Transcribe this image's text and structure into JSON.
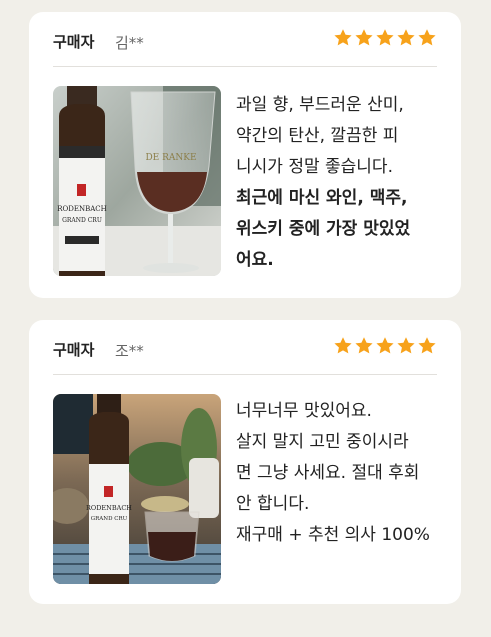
{
  "reviews": [
    {
      "buyer_label": "구매자",
      "buyer_name": "김**",
      "rating": 5,
      "photo": "wine-glass-photo",
      "lines": [
        {
          "text": "과일 향, 부드러운 산미,",
          "bold": false
        },
        {
          "text": "약간의 탄산, 깔끔한 피",
          "bold": false
        },
        {
          "text": "니시가 정말 좋습니다.",
          "bold": false
        },
        {
          "text": "최근에 마신 와인, 맥주,",
          "bold": true
        },
        {
          "text": "위스키 중에 가장 맛있었",
          "bold": true
        },
        {
          "text": "어요.",
          "bold": true
        }
      ]
    },
    {
      "buyer_label": "구매자",
      "buyer_name": "조**",
      "rating": 5,
      "photo": "beer-glass-photo",
      "lines": [
        {
          "text": "너무너무 맛있어요.",
          "bold": false
        },
        {
          "text": "살지 말지 고민 중이시라",
          "bold": false
        },
        {
          "text": "면 그냥 사세요. 절대 후회",
          "bold": false
        },
        {
          "text": "안 합니다.",
          "bold": false
        },
        {
          "text": "재구매 + 추천 의사 100%",
          "bold": false
        }
      ]
    }
  ],
  "colors": {
    "star": "#f7a21b",
    "background": "#f1efe9",
    "card": "#ffffff"
  }
}
